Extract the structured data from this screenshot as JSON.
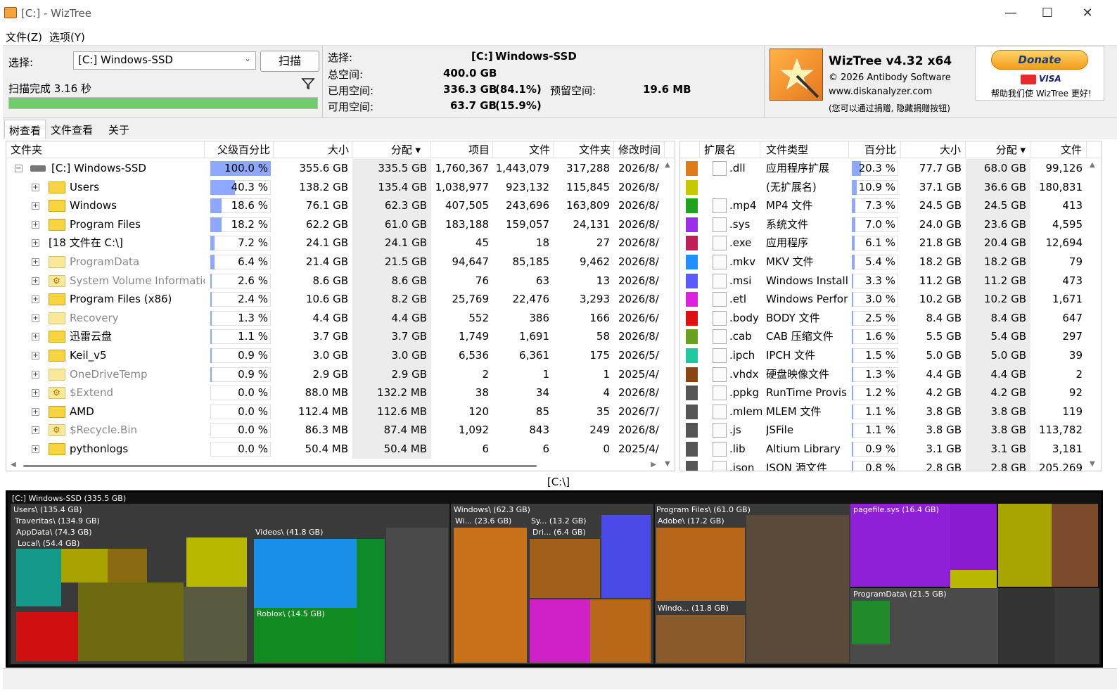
{
  "window": {
    "title": "[C:]  - WizTree"
  },
  "menu": [
    "文件(Z)",
    "选项(Y)"
  ],
  "scan": {
    "select_label": "选择:",
    "drive_value": "[C:] Windows-SSD",
    "scan_button": "扫描",
    "status": "扫描完成 3.16 秒",
    "progress_pct": 100
  },
  "summary": {
    "select_label": "选择:",
    "drive_letter": "[C:]",
    "drive_name": "Windows-SSD",
    "total_label": "总空间:",
    "total_value": "400.0 GB",
    "used_label": "已用空间:",
    "used_value": "336.3 GB",
    "used_pct": "(84.1%)",
    "free_label": "可用空间:",
    "free_value": "63.7 GB",
    "free_pct": "(15.9%)",
    "reserved_label": "预留空间:",
    "reserved_value": "19.6 MB"
  },
  "about": {
    "product": "WizTree v4.32 x64",
    "copyright": "© 2026 Antibody Software",
    "website": "www.diskanalyzer.com",
    "note": "(您可以通过捐赠, 隐藏捐赠按钮)"
  },
  "donate": {
    "button": "Donate",
    "card_text": "VISA",
    "help_text": "帮助我们使 WizTree 更好!"
  },
  "tabs": [
    "树查看",
    "文件查看",
    "关于"
  ],
  "tree": {
    "headers": [
      "文件夹",
      "父级百分比",
      "大小",
      "分配 ▾",
      "项目",
      "文件",
      "文件夹",
      "修改时间"
    ],
    "rows": [
      {
        "name": "[C:] Windows-SSD",
        "pct": "100.0 %",
        "pctv": 100,
        "size": "355.6 GB",
        "alloc": "335.5 GB",
        "items": "1,760,367",
        "files": "1,443,079",
        "folders": "317,288",
        "mod": "2026/8/",
        "type": "drive"
      },
      {
        "name": "Users",
        "pct": "40.3 %",
        "pctv": 40.3,
        "size": "138.2 GB",
        "alloc": "135.4 GB",
        "items": "1,038,977",
        "files": "923,132",
        "folders": "115,845",
        "mod": "2026/8/",
        "type": "folder"
      },
      {
        "name": "Windows",
        "pct": "18.6 %",
        "pctv": 18.6,
        "size": "76.1 GB",
        "alloc": "62.3 GB",
        "items": "407,505",
        "files": "243,696",
        "folders": "163,809",
        "mod": "2026/8/",
        "type": "folder"
      },
      {
        "name": "Program Files",
        "pct": "18.2 %",
        "pctv": 18.2,
        "size": "62.2 GB",
        "alloc": "61.0 GB",
        "items": "183,188",
        "files": "159,057",
        "folders": "24,131",
        "mod": "2026/8/",
        "type": "folder"
      },
      {
        "name": "[18 文件在 C:\\]",
        "pct": "7.2 %",
        "pctv": 7.2,
        "size": "24.1 GB",
        "alloc": "24.1 GB",
        "items": "45",
        "files": "18",
        "folders": "27",
        "mod": "2026/8/",
        "type": "files"
      },
      {
        "name": "ProgramData",
        "pct": "6.4 %",
        "pctv": 6.4,
        "size": "21.4 GB",
        "alloc": "21.5 GB",
        "items": "94,647",
        "files": "85,185",
        "folders": "9,462",
        "mod": "2026/8/",
        "type": "hidden"
      },
      {
        "name": "System Volume Information",
        "pct": "2.6 %",
        "pctv": 2.6,
        "size": "8.6 GB",
        "alloc": "8.6 GB",
        "items": "76",
        "files": "63",
        "folders": "13",
        "mod": "2026/8/",
        "type": "sysfolder"
      },
      {
        "name": "Program Files (x86)",
        "pct": "2.4 %",
        "pctv": 2.4,
        "size": "10.6 GB",
        "alloc": "8.2 GB",
        "items": "25,769",
        "files": "22,476",
        "folders": "3,293",
        "mod": "2026/8/",
        "type": "folder"
      },
      {
        "name": "Recovery",
        "pct": "1.3 %",
        "pctv": 1.3,
        "size": "4.4 GB",
        "alloc": "4.4 GB",
        "items": "552",
        "files": "386",
        "folders": "166",
        "mod": "2026/6/",
        "type": "hidden"
      },
      {
        "name": "迅雷云盘",
        "pct": "1.1 %",
        "pctv": 1.1,
        "size": "3.7 GB",
        "alloc": "3.7 GB",
        "items": "1,749",
        "files": "1,691",
        "folders": "58",
        "mod": "2026/8/",
        "type": "folder"
      },
      {
        "name": "Keil_v5",
        "pct": "0.9 %",
        "pctv": 0.9,
        "size": "3.0 GB",
        "alloc": "3.0 GB",
        "items": "6,536",
        "files": "6,361",
        "folders": "175",
        "mod": "2026/5/",
        "type": "folder"
      },
      {
        "name": "OneDriveTemp",
        "pct": "0.9 %",
        "pctv": 0.9,
        "size": "2.9 GB",
        "alloc": "2.9 GB",
        "items": "2",
        "files": "1",
        "folders": "1",
        "mod": "2025/4/",
        "type": "hidden"
      },
      {
        "name": "$Extend",
        "pct": "0.0 %",
        "pctv": 0,
        "size": "88.0 MB",
        "alloc": "132.2 MB",
        "items": "38",
        "files": "34",
        "folders": "4",
        "mod": "2026/8/",
        "type": "sysfolder"
      },
      {
        "name": "AMD",
        "pct": "0.0 %",
        "pctv": 0,
        "size": "112.4 MB",
        "alloc": "112.6 MB",
        "items": "120",
        "files": "85",
        "folders": "35",
        "mod": "2026/7/",
        "type": "folder"
      },
      {
        "name": "$Recycle.Bin",
        "pct": "0.0 %",
        "pctv": 0,
        "size": "86.3 MB",
        "alloc": "87.4 MB",
        "items": "1,092",
        "files": "843",
        "folders": "249",
        "mod": "2026/8/",
        "type": "sysfolder"
      },
      {
        "name": "pythonlogs",
        "pct": "0.0 %",
        "pctv": 0,
        "size": "50.4 MB",
        "alloc": "50.4 MB",
        "items": "6",
        "files": "6",
        "folders": "0",
        "mod": "2025/4/",
        "type": "folder"
      }
    ]
  },
  "ext": {
    "headers": [
      "扩展名",
      "文件类型",
      "百分比",
      "大小",
      "分配 ▾",
      "文件"
    ],
    "rows": [
      {
        "color": "#e07b1a",
        "ext": ".dll",
        "type": "应用程序扩展",
        "pct": "20.3 %",
        "pctv": 20.3,
        "size": "77.7 GB",
        "alloc": "68.0 GB",
        "files": "99,126"
      },
      {
        "color": "#c8c800",
        "ext": "",
        "type": "(无扩展名)",
        "pct": "10.9 %",
        "pctv": 10.9,
        "size": "37.1 GB",
        "alloc": "36.6 GB",
        "files": "180,831"
      },
      {
        "color": "#1fa31f",
        "ext": ".mp4",
        "type": "MP4 文件",
        "pct": "7.3 %",
        "pctv": 7.3,
        "size": "24.5 GB",
        "alloc": "24.5 GB",
        "files": "413"
      },
      {
        "color": "#9b2ee8",
        "ext": ".sys",
        "type": "系统文件",
        "pct": "7.0 %",
        "pctv": 7.0,
        "size": "24.0 GB",
        "alloc": "23.6 GB",
        "files": "4,595"
      },
      {
        "color": "#c0205a",
        "ext": ".exe",
        "type": "应用程序",
        "pct": "6.1 %",
        "pctv": 6.1,
        "size": "21.8 GB",
        "alloc": "20.4 GB",
        "files": "12,694"
      },
      {
        "color": "#1e90ff",
        "ext": ".mkv",
        "type": "MKV 文件",
        "pct": "5.4 %",
        "pctv": 5.4,
        "size": "18.2 GB",
        "alloc": "18.2 GB",
        "files": "79"
      },
      {
        "color": "#5a5aff",
        "ext": ".msi",
        "type": "Windows Installe",
        "pct": "3.3 %",
        "pctv": 3.3,
        "size": "11.2 GB",
        "alloc": "11.2 GB",
        "files": "473"
      },
      {
        "color": "#e020e0",
        "ext": ".etl",
        "type": "Windows Perfori",
        "pct": "3.0 %",
        "pctv": 3.0,
        "size": "10.2 GB",
        "alloc": "10.2 GB",
        "files": "1,671"
      },
      {
        "color": "#e01010",
        "ext": ".body",
        "type": "BODY 文件",
        "pct": "2.5 %",
        "pctv": 2.5,
        "size": "8.4 GB",
        "alloc": "8.4 GB",
        "files": "647"
      },
      {
        "color": "#6aa020",
        "ext": ".cab",
        "type": "CAB 压缩文件",
        "pct": "1.6 %",
        "pctv": 1.6,
        "size": "5.5 GB",
        "alloc": "5.4 GB",
        "files": "297"
      },
      {
        "color": "#20c8a0",
        "ext": ".ipch",
        "type": "IPCH 文件",
        "pct": "1.5 %",
        "pctv": 1.5,
        "size": "5.0 GB",
        "alloc": "5.0 GB",
        "files": "39"
      },
      {
        "color": "#8b4513",
        "ext": ".vhdx",
        "type": "硬盘映像文件",
        "pct": "1.3 %",
        "pctv": 1.3,
        "size": "4.4 GB",
        "alloc": "4.4 GB",
        "files": "2"
      },
      {
        "color": "#555555",
        "ext": ".ppkg",
        "type": "RunTime Provisi",
        "pct": "1.2 %",
        "pctv": 1.2,
        "size": "4.2 GB",
        "alloc": "4.2 GB",
        "files": "92"
      },
      {
        "color": "#555555",
        "ext": ".mlem",
        "type": "MLEM 文件",
        "pct": "1.1 %",
        "pctv": 1.1,
        "size": "3.8 GB",
        "alloc": "3.8 GB",
        "files": "119"
      },
      {
        "color": "#555555",
        "ext": ".js",
        "type": "JSFile",
        "pct": "1.1 %",
        "pctv": 1.1,
        "size": "3.8 GB",
        "alloc": "3.8 GB",
        "files": "113,782"
      },
      {
        "color": "#555555",
        "ext": ".lib",
        "type": "Altium Library",
        "pct": "0.9 %",
        "pctv": 0.9,
        "size": "3.1 GB",
        "alloc": "3.1 GB",
        "files": "3,181"
      },
      {
        "color": "#555555",
        "ext": ".json",
        "type": "JSON 源文件",
        "pct": "0.8 %",
        "pctv": 0.8,
        "size": "2.8 GB",
        "alloc": "2.8 GB",
        "files": "205,269"
      }
    ]
  },
  "path": "[C:\\]",
  "treemap": {
    "root": "[C:] Windows-SSD  (335.5 GB)",
    "labels": {
      "users": "Users\\ (135.4 GB)",
      "traveritas": "Traveritas\\ (134.9 GB)",
      "appdata": "AppData\\ (74.3 GB)",
      "local": "Local\\ (54.4 GB)",
      "videos": "Videos\\ (41.8 GB)",
      "roblox": "Roblox\\ (14.5 GB)",
      "windows": "Windows\\ (62.3 GB)",
      "winsxs": "Wi... (23.6 GB)",
      "sys": "Sy... (13.2 GB)",
      "dri": "Dri... (6.4 GB)",
      "progfiles": "Program Files\\ (61.0 GB)",
      "adobe": "Adobe\\ (17.2 GB)",
      "windo": "Windo... (11.8 GB)",
      "pagefile": "pagefile.sys (16.4 GB)",
      "programdata": "ProgramData\\ (21.5 GB)"
    }
  }
}
